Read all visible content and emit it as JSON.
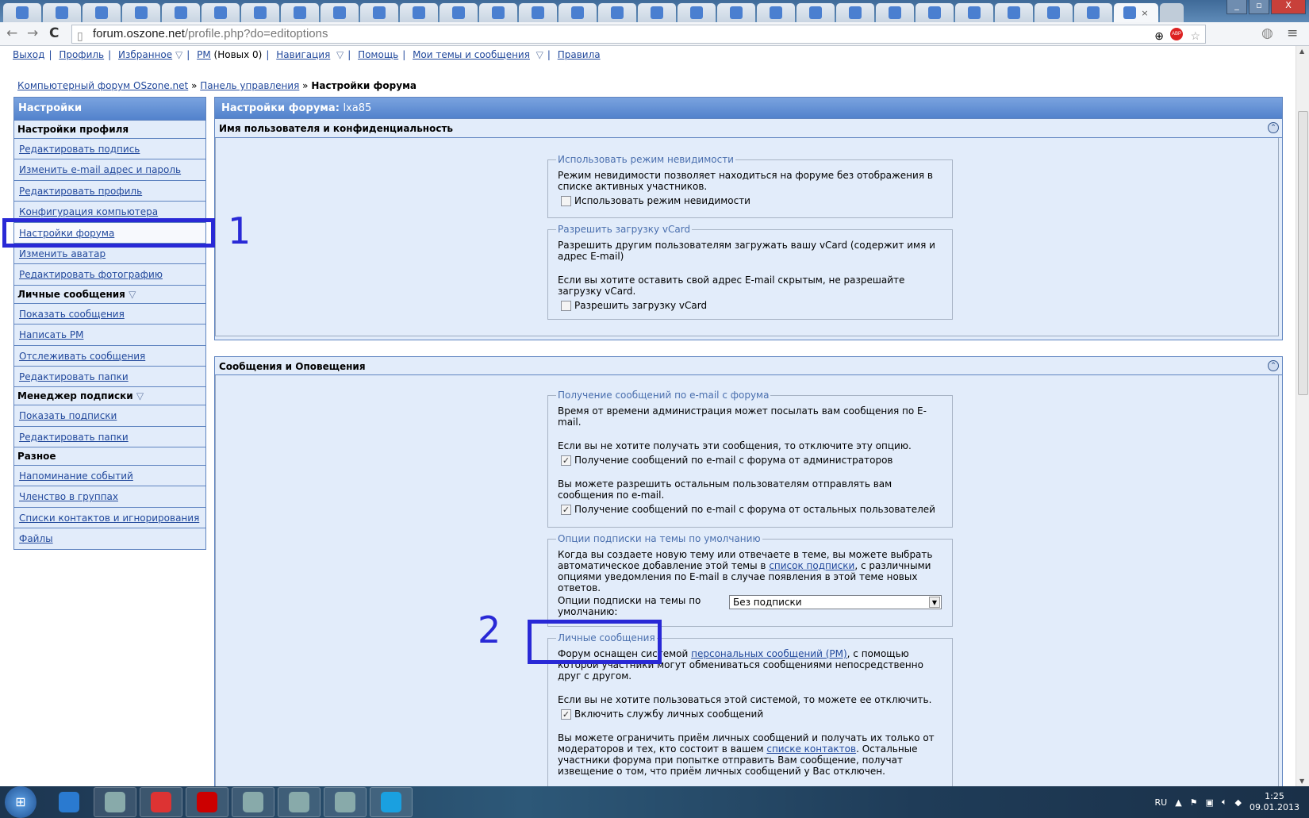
{
  "browser": {
    "tabs": [
      {
        "icon": "grid-icon"
      },
      {
        "icon": "rocket-icon"
      },
      {
        "icon": "eye-icon"
      },
      {
        "icon": "eye-icon"
      },
      {
        "icon": "google-plus-icon"
      },
      {
        "icon": "google-plus-icon"
      },
      {
        "icon": "penguin-icon"
      },
      {
        "icon": "star-icon"
      },
      {
        "icon": "tux-icon"
      },
      {
        "icon": "chart-icon"
      },
      {
        "icon": "tux-icon"
      },
      {
        "icon": "tux-icon"
      },
      {
        "icon": "tux-icon"
      },
      {
        "icon": "tux-icon"
      },
      {
        "icon": "page-icon"
      },
      {
        "icon": "google-plus-icon"
      },
      {
        "icon": "vk-icon"
      },
      {
        "icon": "stripes-icon"
      },
      {
        "icon": "google-plus-icon"
      },
      {
        "icon": "color-squares-icon"
      },
      {
        "icon": "google-plus-icon"
      },
      {
        "icon": "utorrent-icon"
      },
      {
        "icon": "bird-icon"
      },
      {
        "icon": "ddwrt-icon"
      },
      {
        "icon": "page-icon"
      },
      {
        "icon": "oszone-icon"
      },
      {
        "icon": "oszone-icon"
      },
      {
        "icon": "image-icon"
      },
      {
        "icon": "oszone-icon",
        "active": true,
        "close": "×"
      }
    ],
    "url_host": "forum.oszone.net",
    "url_path": "/profile.php?do=editoptions",
    "abp_label": "ABP"
  },
  "topnav": {
    "logout": "Выход",
    "profile": "Профиль",
    "favorites": "Избранное",
    "pm": "PM",
    "pm_new": "(Новых 0)",
    "navigation": "Навигация",
    "help": "Помощь",
    "my_topics": "Мои темы и сообщения",
    "rules": "Правила"
  },
  "breadcrumb": {
    "home": "Компьютерный форум OSzone.net",
    "sep": "»",
    "cp": "Панель управления",
    "current": "Настройки форума"
  },
  "sidebar": {
    "title": "Настройки",
    "groups": [
      {
        "label": "Настройки профиля",
        "items": [
          "Редактировать подпись",
          "Изменить e-mail адрес и пароль",
          "Редактировать профиль",
          "Конфигурация компьютера",
          "Настройки форума",
          "Изменить аватар",
          "Редактировать фотографию"
        ]
      },
      {
        "label": "Личные сообщения",
        "items": [
          "Показать сообщения",
          "Написать PM",
          "Отслеживать сообщения",
          "Редактировать папки"
        ]
      },
      {
        "label": "Менеджер подписки",
        "items": [
          "Показать подписки",
          "Редактировать папки"
        ]
      },
      {
        "label": "Разное",
        "items": [
          "Напоминание событий",
          "Членство в группах",
          "Списки контактов и игнорирования",
          "Файлы"
        ]
      }
    ]
  },
  "main": {
    "title": "Настройки форума:",
    "username": "lxa85",
    "section1": {
      "title": "Имя пользователя и конфиденциальность",
      "invisible": {
        "legend": "Использовать режим невидимости",
        "desc": "Режим невидимости позволяет находиться на форуме без отображения в списке активных участников.",
        "checkbox": "Использовать режим невидимости",
        "checked": false
      },
      "vcard": {
        "legend": "Разрешить загрузку vCard",
        "desc1": "Разрешить другим пользователям загружать вашу vCard (содержит имя и адрес E-mail)",
        "desc2": "Если вы хотите оставить свой адрес E-mail скрытым, не разрешайте загрузку vCard.",
        "checkbox": "Разрешить загрузку vCard",
        "checked": false
      }
    },
    "section2": {
      "title": "Сообщения и Оповещения",
      "email": {
        "legend": "Получение сообщений по e-mail с форума",
        "desc1": "Время от времени администрация может посылать вам сообщения по E-mail.",
        "desc2": "Если вы не хотите получать эти сообщения, то отключите эту опцию.",
        "checkbox1": "Получение сообщений по e-mail с форума от администраторов",
        "desc3": "Вы можете разрешить остальным пользователям отправлять вам сообщения по e-mail.",
        "checkbox2": "Получение сообщений по e-mail с форума от остальных пользователей",
        "checked1": true,
        "checked2": true
      },
      "subscr": {
        "legend": "Опции подписки на темы по умолчанию",
        "desc_a": "Когда вы создаете новую тему или отвечаете в теме, вы можете выбрать автоматическое добавление этой темы в ",
        "desc_link": "список подписки",
        "desc_b": ", с различными опциями уведомления по E-mail в случае появления в этой теме новых ответов.",
        "select_label": "Опции подписки на темы по умолчанию:",
        "select_value": "Без подписки"
      },
      "pm": {
        "legend": "Личные сообщения",
        "desc_a": "Форум оснащен системой ",
        "desc_link": "персональных сообщений (PM)",
        "desc_b": ", с помощью которой участники могут обмениваться сообщениями непосредственно друг с другом.",
        "desc2": "Если вы не хотите пользоваться этой системой, то можете ее отключить.",
        "checkbox": "Включить службу личных сообщений",
        "checked": true,
        "desc3_a": "Вы можете ограничить приём личных сообщений и получать их только от модераторов и тех, кто состоит в вашем ",
        "desc3_link": "списке контактов",
        "desc3_b": ". Остальные участники форума при попытке отправить Вам сообщение, получат извещение о том, что приём личных сообщений у Вас отключен."
      }
    }
  },
  "annotations": {
    "one": "1",
    "two": "2",
    "color": "#2929d6"
  },
  "taskbar": {
    "apps": [
      "ie-icon",
      "explorer-icon",
      "chrome-icon",
      "opera-icon",
      "notepad-icon",
      "remote-desktop-icon",
      "virtualbox-icon",
      "skype-icon"
    ],
    "lang": "RU",
    "time": "1:25",
    "date": "09.01.2013"
  }
}
